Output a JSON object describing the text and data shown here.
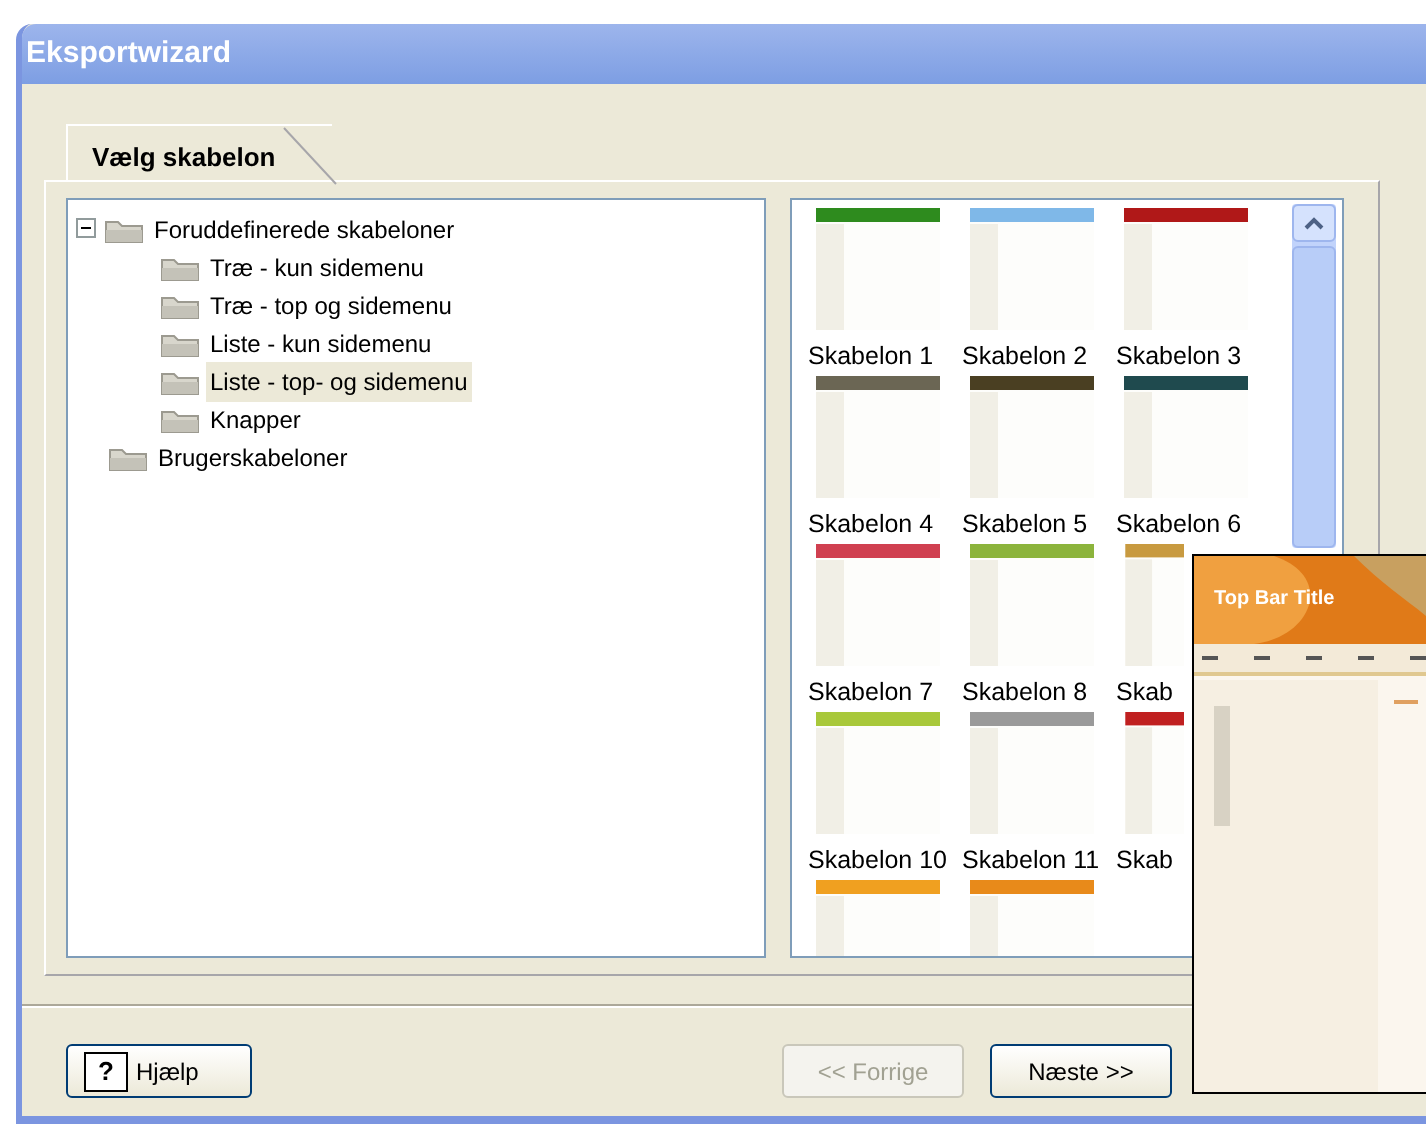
{
  "window": {
    "title": "Eksportwizard"
  },
  "tabs": [
    {
      "label": "Vælg skabelon",
      "selected": true
    }
  ],
  "tree": [
    {
      "label": "Foruddefinerede skabeloner",
      "expanded": true,
      "selected": false,
      "children": [
        {
          "label": "Træ - kun sidemenu",
          "selected": false
        },
        {
          "label": "Træ - top og sidemenu",
          "selected": false
        },
        {
          "label": "Liste - kun sidemenu",
          "selected": false
        },
        {
          "label": "Liste - top- og sidemenu",
          "selected": true
        },
        {
          "label": "Knapper",
          "selected": false
        }
      ]
    },
    {
      "label": "Brugerskabeloner",
      "selected": false
    }
  ],
  "templates": [
    {
      "label": "Skabelon 1",
      "color": "#2e8b1e"
    },
    {
      "label": "Skabelon 2",
      "color": "#7fb8e8"
    },
    {
      "label": "Skabelon 3",
      "color": "#b01818"
    },
    {
      "label": "Skabelon 4",
      "color": "#6b6654"
    },
    {
      "label": "Skabelon 5",
      "color": "#4a3f22"
    },
    {
      "label": "Skabelon 6",
      "color": "#1f4a4e"
    },
    {
      "label": "Skabelon 7",
      "color": "#d04050"
    },
    {
      "label": "Skabelon 8",
      "color": "#8cb43c"
    },
    {
      "label": "Skab",
      "color": "#c89a40",
      "covered": true
    },
    {
      "label": "Skabelon 10",
      "color": "#a8c83a"
    },
    {
      "label": "Skabelon 11",
      "color": "#9a9a9a"
    },
    {
      "label": "Skab",
      "color": "#c02020",
      "covered": true
    },
    {
      "color": "#f0a020"
    },
    {
      "color": "#e88a1a"
    }
  ],
  "preview": {
    "title": "Top Bar Title"
  },
  "buttons": [
    {
      "kind": "help",
      "icon_glyph": "?",
      "label": "Hjælp",
      "disabled": false
    },
    {
      "kind": "nav",
      "label": "<< Forrige",
      "disabled": true
    },
    {
      "kind": "nav",
      "label": "Næste >>",
      "disabled": false
    }
  ]
}
